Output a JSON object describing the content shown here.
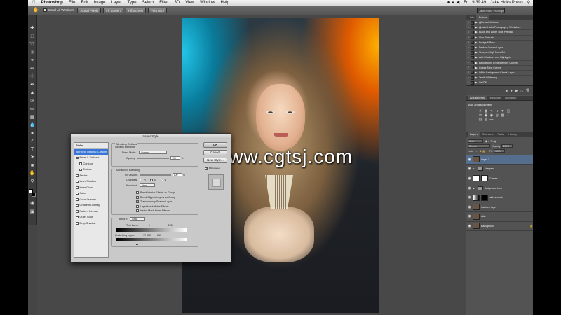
{
  "menubar": {
    "app": "Photoshop",
    "items": [
      "File",
      "Edit",
      "Image",
      "Layer",
      "Type",
      "Select",
      "Filter",
      "3D",
      "View",
      "Window",
      "Help"
    ],
    "clock": "Fri 19:39:49",
    "user": "Jake Hicks Photo"
  },
  "options_bar": {
    "scroll_all": "Scroll All Windows",
    "buttons": [
      "Actual Pixels",
      "Fit Screen",
      "Fill Screen",
      "Print Size"
    ],
    "workspace": "Jake Hicks Photography"
  },
  "toolbar": {
    "tools": [
      "move-icon",
      "marquee-icon",
      "lasso-icon",
      "quick-select-icon",
      "crop-icon",
      "eyedropper-icon",
      "healing-icon",
      "brush-icon",
      "stamp-icon",
      "history-brush-icon",
      "eraser-icon",
      "gradient-icon",
      "blur-icon",
      "dodge-icon",
      "pen-icon",
      "type-icon",
      "path-select-icon",
      "shape-icon",
      "hand-icon",
      "zoom-icon"
    ]
  },
  "watermark": "www.cgtsj.com",
  "layer_style_dialog": {
    "title": "Layer Style",
    "styles_header": "Styles",
    "styles": [
      {
        "label": "Blending Options: Custom",
        "selected": true,
        "indent": false,
        "checkbox": false
      },
      {
        "label": "Bevel & Emboss",
        "indent": false,
        "checkbox": true
      },
      {
        "label": "Contour",
        "indent": true,
        "checkbox": true
      },
      {
        "label": "Texture",
        "indent": true,
        "checkbox": true
      },
      {
        "label": "Stroke",
        "indent": false,
        "checkbox": true
      },
      {
        "label": "Inner Shadow",
        "indent": false,
        "checkbox": true
      },
      {
        "label": "Inner Glow",
        "indent": false,
        "checkbox": true
      },
      {
        "label": "Satin",
        "indent": false,
        "checkbox": true
      },
      {
        "label": "Color Overlay",
        "indent": false,
        "checkbox": true
      },
      {
        "label": "Gradient Overlay",
        "indent": false,
        "checkbox": true
      },
      {
        "label": "Pattern Overlay",
        "indent": false,
        "checkbox": true
      },
      {
        "label": "Outer Glow",
        "indent": false,
        "checkbox": true
      },
      {
        "label": "Drop Shadow",
        "indent": false,
        "checkbox": true
      }
    ],
    "blending_options": {
      "title": "Blending Options",
      "general_title": "General Blending",
      "blend_mode_label": "Blend Mode:",
      "blend_mode": "Screen",
      "opacity_label": "Opacity:",
      "opacity": "100",
      "percent": "%"
    },
    "advanced": {
      "title": "Advanced Blending",
      "fill_opacity_label": "Fill Opacity:",
      "fill_opacity": "100",
      "channels_label": "Channels:",
      "channels": [
        "R",
        "G",
        "B"
      ],
      "knockout_label": "Knockout:",
      "knockout": "None",
      "checks": [
        {
          "label": "Blend Interior Effects as Group",
          "checked": false
        },
        {
          "label": "Blend Clipped Layers as Group",
          "checked": true
        },
        {
          "label": "Transparency Shapes Layer",
          "checked": true
        },
        {
          "label": "Layer Mask Hides Effects",
          "checked": false
        },
        {
          "label": "Vector Mask Hides Effects",
          "checked": false
        }
      ]
    },
    "blend_if": {
      "label": "Blend If:",
      "channel": "Gray",
      "this_layer_label": "This Layer:",
      "this_layer_low": "0",
      "this_layer_high": "255",
      "underlying_label": "Underlying Layer:",
      "underlying_low": "77",
      "underlying_split": "255",
      "underlying_high": "255"
    },
    "buttons": {
      "ok": "OK",
      "cancel": "Cancel",
      "new_style": "New Style...",
      "preview": "Preview"
    }
  },
  "actions_panel": {
    "tabs": [
      "Info",
      "Actions"
    ],
    "rows": [
      {
        "label": "Default Actions",
        "type": "set"
      },
      {
        "label": "Jake Hicks Photography Worksho...",
        "type": "set"
      },
      {
        "label": "Black and White Tone Preview",
        "type": "action"
      },
      {
        "label": "Skin Retouch",
        "type": "action"
      },
      {
        "label": "Dodge & Burn",
        "type": "action"
      },
      {
        "label": "Darken Curves Layer",
        "type": "action"
      },
      {
        "label": "Sharpen High Pass Set",
        "type": "action"
      },
      {
        "label": "Add Shadows and Highlights",
        "type": "action"
      },
      {
        "label": "Background Enhancement Curves",
        "type": "action"
      },
      {
        "label": "Colour Tone Curves",
        "type": "action"
      },
      {
        "label": "White Background Check Layer",
        "type": "action"
      },
      {
        "label": "Teeth Whitening",
        "type": "action"
      },
      {
        "label": "On/Off",
        "type": "action"
      }
    ]
  },
  "adjustments_panel": {
    "tabs": [
      "Adjustments",
      "Histogram",
      "Navigator"
    ],
    "title": "Add an adjustment"
  },
  "layers_panel": {
    "tabs": [
      "Layers",
      "Channels",
      "Paths",
      "History"
    ],
    "kind_label": "Kind",
    "blend_mode": "Screen",
    "opacity_label": "Opacity:",
    "opacity": "100%",
    "lock_label": "Lock:",
    "fill_label": "Fill:",
    "fill": "100%",
    "layers": [
      {
        "name": "Layer 1",
        "selected": true,
        "kind": "image"
      },
      {
        "name": "sharpen",
        "kind": "folder"
      },
      {
        "name": "Curves 1",
        "kind": "adjust"
      },
      {
        "name": "dodge and burn",
        "kind": "folder"
      },
      {
        "name": "skin smooth",
        "kind": "mask"
      },
      {
        "name": "low tone layer",
        "kind": "image"
      },
      {
        "name": "skin",
        "kind": "image"
      },
      {
        "name": "Background",
        "kind": "image",
        "locked": true
      }
    ]
  }
}
